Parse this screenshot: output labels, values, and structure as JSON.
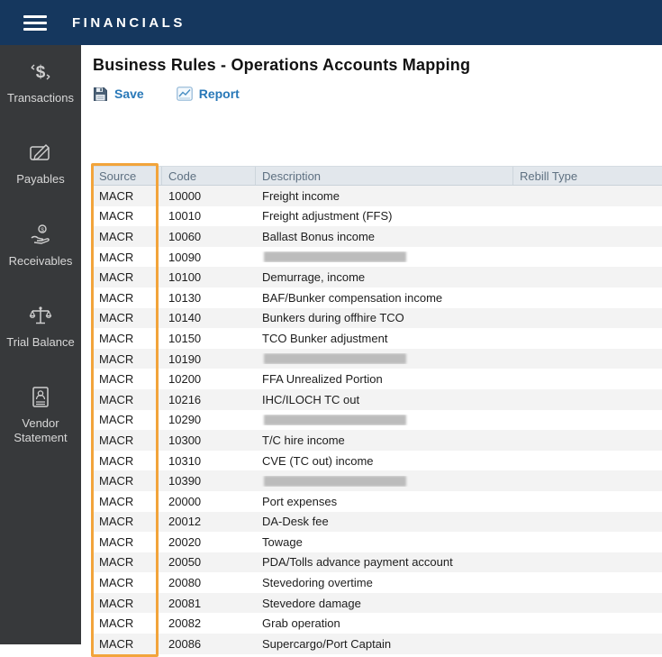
{
  "colors": {
    "topbar_navy": "#15375E",
    "sidebar_gray": "#37393B",
    "link_blue": "#2878B8",
    "highlight_orange": "#F2A43B",
    "header_row_bg": "#E2E7EC"
  },
  "topbar": {
    "app_title": "FINANCIALS"
  },
  "sidebar": {
    "items": [
      {
        "label": "Transactions",
        "icon": "transactions-dollar-icon"
      },
      {
        "label": "Payables",
        "icon": "payables-pen-icon"
      },
      {
        "label": "Receivables",
        "icon": "receivables-hand-coin-icon"
      },
      {
        "label": "Trial Balance",
        "icon": "trial-balance-scale-icon"
      },
      {
        "label": "Vendor Statement",
        "icon": "vendor-statement-document-icon"
      }
    ]
  },
  "main": {
    "page_title": "Business Rules - Operations Accounts Mapping",
    "toolbar": {
      "save_label": "Save",
      "report_label": "Report"
    },
    "table": {
      "columns": [
        "Source",
        "Code",
        "Description",
        "Rebill Type"
      ],
      "highlighted_column": "Source",
      "rows": [
        {
          "source": "MACR",
          "code": "10000",
          "description": "Freight income",
          "rebill_type": "",
          "redacted": false
        },
        {
          "source": "MACR",
          "code": "10010",
          "description": "Freight adjustment (FFS)",
          "rebill_type": "",
          "redacted": false
        },
        {
          "source": "MACR",
          "code": "10060",
          "description": "Ballast Bonus income",
          "rebill_type": "",
          "redacted": false
        },
        {
          "source": "MACR",
          "code": "10090",
          "description": "",
          "rebill_type": "",
          "redacted": true
        },
        {
          "source": "MACR",
          "code": "10100",
          "description": "Demurrage, income",
          "rebill_type": "",
          "redacted": false
        },
        {
          "source": "MACR",
          "code": "10130",
          "description": "BAF/Bunker compensation income",
          "rebill_type": "",
          "redacted": false
        },
        {
          "source": "MACR",
          "code": "10140",
          "description": "Bunkers during offhire TCO",
          "rebill_type": "",
          "redacted": false
        },
        {
          "source": "MACR",
          "code": "10150",
          "description": "TCO Bunker adjustment",
          "rebill_type": "",
          "redacted": false
        },
        {
          "source": "MACR",
          "code": "10190",
          "description": "",
          "rebill_type": "",
          "redacted": true
        },
        {
          "source": "MACR",
          "code": "10200",
          "description": "FFA Unrealized Portion",
          "rebill_type": "",
          "redacted": false
        },
        {
          "source": "MACR",
          "code": "10216",
          "description": "IHC/ILOCH TC out",
          "rebill_type": "",
          "redacted": false
        },
        {
          "source": "MACR",
          "code": "10290",
          "description": "",
          "rebill_type": "",
          "redacted": true
        },
        {
          "source": "MACR",
          "code": "10300",
          "description": "T/C hire income",
          "rebill_type": "",
          "redacted": false
        },
        {
          "source": "MACR",
          "code": "10310",
          "description": "CVE (TC out) income",
          "rebill_type": "",
          "redacted": false
        },
        {
          "source": "MACR",
          "code": "10390",
          "description": "",
          "rebill_type": "",
          "redacted": true
        },
        {
          "source": "MACR",
          "code": "20000",
          "description": "Port expenses",
          "rebill_type": "",
          "redacted": false
        },
        {
          "source": "MACR",
          "code": "20012",
          "description": "DA-Desk fee",
          "rebill_type": "",
          "redacted": false
        },
        {
          "source": "MACR",
          "code": "20020",
          "description": "Towage",
          "rebill_type": "",
          "redacted": false
        },
        {
          "source": "MACR",
          "code": "20050",
          "description": "PDA/Tolls advance payment account",
          "rebill_type": "",
          "redacted": false
        },
        {
          "source": "MACR",
          "code": "20080",
          "description": "Stevedoring overtime",
          "rebill_type": "",
          "redacted": false
        },
        {
          "source": "MACR",
          "code": "20081",
          "description": "Stevedore damage",
          "rebill_type": "",
          "redacted": false
        },
        {
          "source": "MACR",
          "code": "20082",
          "description": "Grab operation",
          "rebill_type": "",
          "redacted": false
        },
        {
          "source": "MACR",
          "code": "20086",
          "description": "Supercargo/Port Captain",
          "rebill_type": "",
          "redacted": false
        }
      ]
    }
  }
}
